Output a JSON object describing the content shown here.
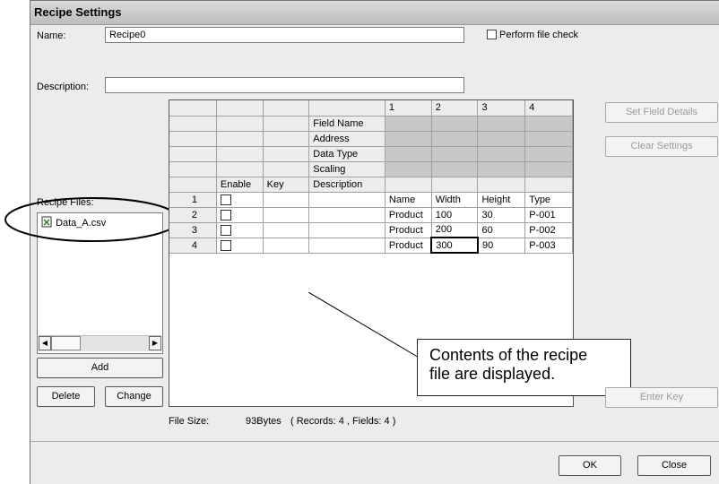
{
  "window": {
    "title": "Recipe Settings"
  },
  "form": {
    "name_label": "Name:",
    "name_value": "Recipe0",
    "description_label": "Description:",
    "description_value": "",
    "file_check_label": "Perform file check"
  },
  "recipe_files": {
    "label": "Recipe Files:",
    "items": [
      "Data_A.csv"
    ]
  },
  "buttons": {
    "add": "Add",
    "delete": "Delete",
    "change": "Change",
    "set_field_details": "Set Field Details",
    "clear_settings": "Clear Settings",
    "enter_key": "Enter Key",
    "ok": "OK",
    "close": "Close"
  },
  "grid": {
    "field_labels": [
      "Field Name",
      "Address",
      "Data Type",
      "Scaling",
      "Description"
    ],
    "column_numbers": [
      "1",
      "2",
      "3",
      "4"
    ],
    "header": {
      "enable": "Enable",
      "key": "Key",
      "description": "Description"
    },
    "rows": [
      {
        "num": "1",
        "values": [
          "Name",
          "Width",
          "Height",
          "Type"
        ]
      },
      {
        "num": "2",
        "values": [
          "Product",
          "100",
          "30",
          "P-001"
        ]
      },
      {
        "num": "3",
        "values": [
          "Product",
          "200",
          "60",
          "P-002"
        ]
      },
      {
        "num": "4",
        "values": [
          "Product",
          "300",
          "90",
          "P-003"
        ]
      }
    ]
  },
  "file_size": {
    "label": "File Size:",
    "value": "93Bytes",
    "detail": "( Records: 4 , Fields: 4 )"
  },
  "callout": {
    "line1": "Contents of the recipe",
    "line2": "file are displayed."
  }
}
